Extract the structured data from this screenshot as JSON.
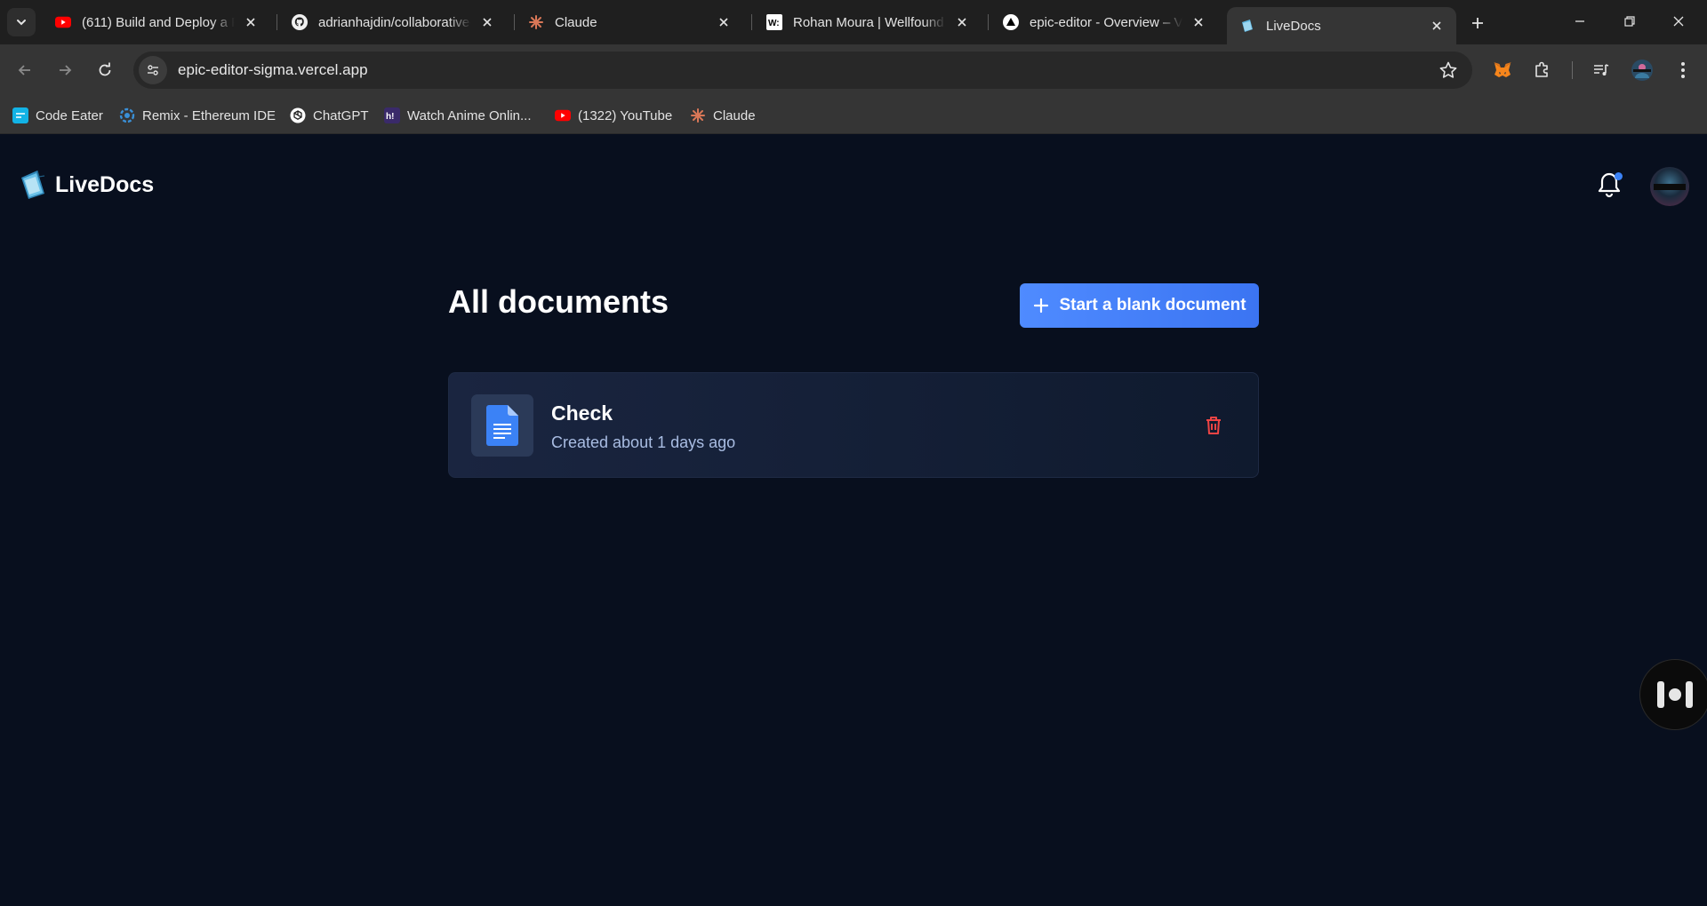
{
  "browser": {
    "tabs": [
      {
        "title": "(611) Build and Deploy a R",
        "favicon": "youtube-icon"
      },
      {
        "title": "adrianhajdin/collaborative-",
        "favicon": "github-icon"
      },
      {
        "title": "Claude",
        "favicon": "claude-icon"
      },
      {
        "title": "Rohan Moura | Wellfound (",
        "favicon": "wellfound-icon"
      },
      {
        "title": "epic-editor - Overview – Ve",
        "favicon": "vercel-icon"
      },
      {
        "title": "LiveDocs",
        "favicon": "livedocs-icon",
        "active": true
      }
    ],
    "url": "epic-editor-sigma.vercel.app",
    "bookmarks": [
      {
        "label": "Code Eater",
        "favicon": "code-eater-icon"
      },
      {
        "label": "Remix - Ethereum IDE",
        "favicon": "remix-icon"
      },
      {
        "label": "ChatGPT",
        "favicon": "chatgpt-icon"
      },
      {
        "label": "Watch Anime Onlin...",
        "favicon": "hianime-icon"
      },
      {
        "label": "(1322) YouTube",
        "favicon": "youtube-icon"
      },
      {
        "label": "Claude",
        "favicon": "claude-icon"
      }
    ]
  },
  "app": {
    "brand": "LiveDocs",
    "heading": "All documents",
    "new_doc_label": "Start a blank document",
    "documents": [
      {
        "title": "Check",
        "meta": "Created about 1 days ago"
      }
    ]
  },
  "colors": {
    "accent": "#3b82f6",
    "page_bg": "#080f1e",
    "delete": "#ef4444"
  }
}
